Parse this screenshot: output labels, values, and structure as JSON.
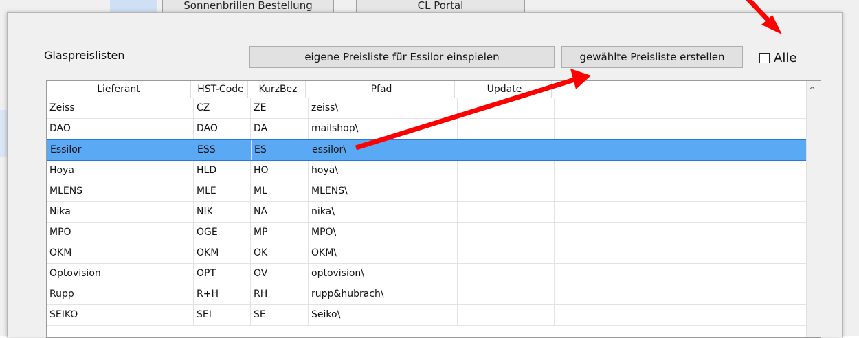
{
  "background": {
    "tab_sunglasses": "Sonnenbrillen Bestellung",
    "tab_cl_portal": "CL Portal"
  },
  "dialog": {
    "title": "Glaspreislisten",
    "btn_essilor": "eigene Preisliste für Essilor einspielen",
    "btn_create": "gewählte Preisliste erstellen",
    "chk_all_label": "Alle",
    "chk_all_checked": false
  },
  "table": {
    "columns": [
      "Lieferant",
      "HST-Code",
      "KurzBez",
      "Pfad",
      "Update",
      ""
    ],
    "selected_row": 2,
    "rows": [
      [
        "Zeiss",
        "CZ",
        "ZE",
        "zeiss\\",
        "",
        ""
      ],
      [
        "DAO",
        "DAO",
        "DA",
        "mailshop\\",
        "",
        ""
      ],
      [
        "Essilor",
        "ESS",
        "ES",
        "essilor\\",
        "",
        ""
      ],
      [
        "Hoya",
        "HLD",
        "HO",
        "hoya\\",
        "",
        ""
      ],
      [
        "MLENS",
        "MLE",
        "ML",
        "MLENS\\",
        "",
        ""
      ],
      [
        "Nika",
        "NIK",
        "NA",
        "nika\\",
        "",
        ""
      ],
      [
        "MPO",
        "OGE",
        "MP",
        "MPO\\",
        "",
        ""
      ],
      [
        "OKM",
        "OKM",
        "OK",
        "OKM\\",
        "",
        ""
      ],
      [
        "Optovision",
        "OPT",
        "OV",
        "optovision\\",
        "",
        ""
      ],
      [
        "Rupp",
        "R+H",
        "RH",
        "rupp&hubrach\\",
        "",
        ""
      ],
      [
        "SEIKO",
        "SEI",
        "SE",
        "Seiko\\",
        "",
        ""
      ]
    ]
  },
  "colors": {
    "selection": "#59a9f5",
    "arrow": "#ff0000"
  }
}
